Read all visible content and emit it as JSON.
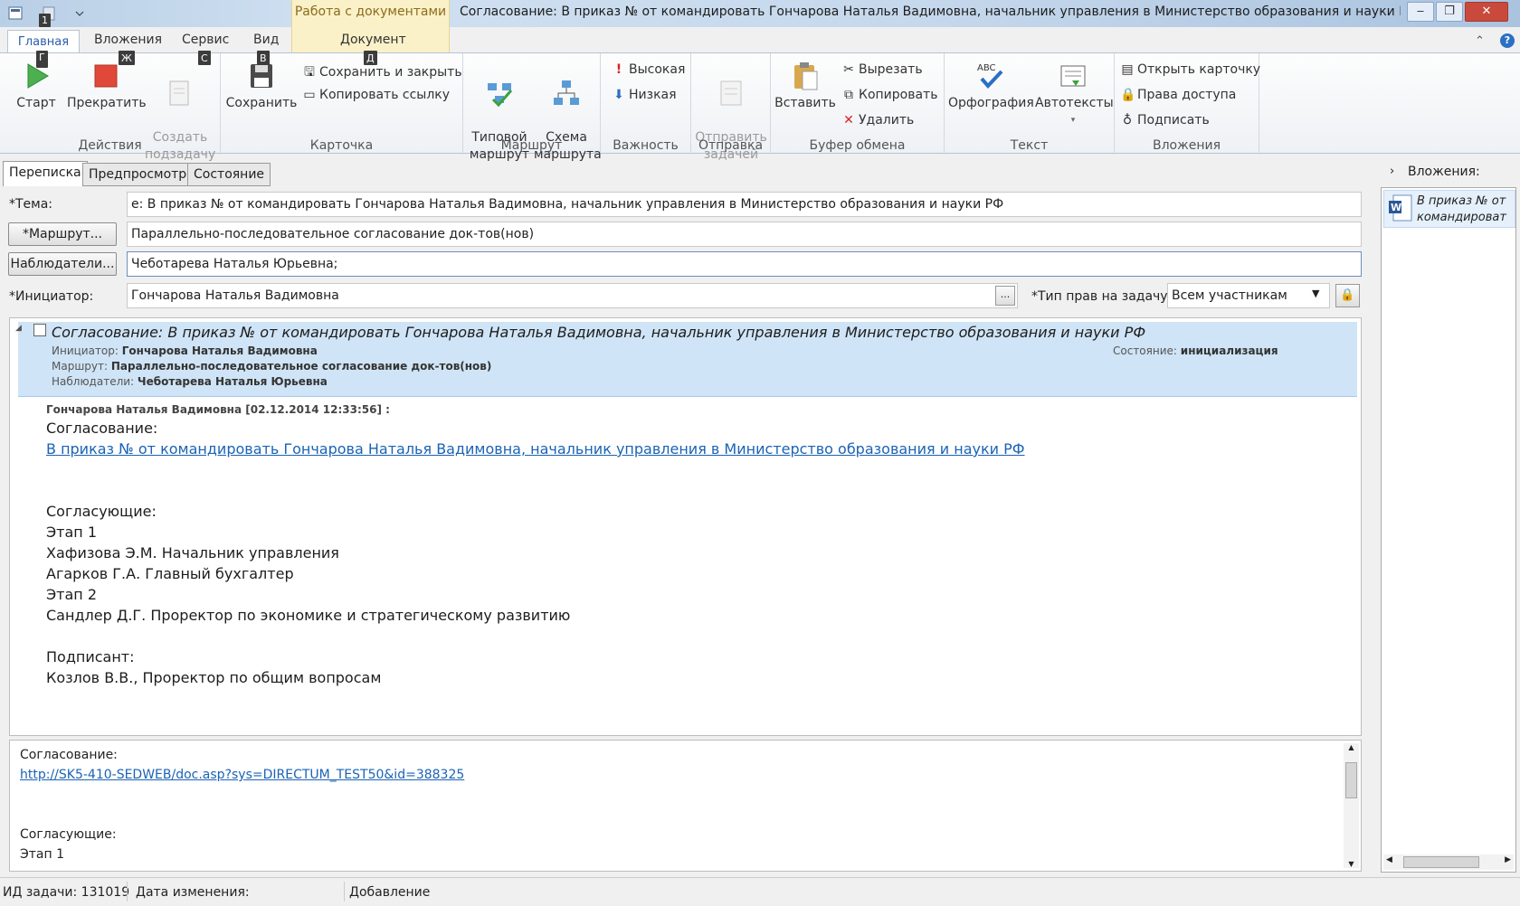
{
  "app": {
    "context_tab_label": "Работа с документами",
    "window_title": "Согласование: В приказ № от  командировать Гончарова Наталья Вадимовна, начальник управления в Министерство образования и науки РФ -"
  },
  "ribbon_tabs": [
    {
      "label": "Главная",
      "keytip": "Г"
    },
    {
      "label": "Вложения",
      "keytip": "Ж"
    },
    {
      "label": "Сервис",
      "keytip": "С"
    },
    {
      "label": "Вид",
      "keytip": "В"
    },
    {
      "label": "Документ",
      "keytip": "Д"
    }
  ],
  "quick_access_keytip": "1",
  "groups": {
    "actions": {
      "label": "Действия",
      "start": "Старт",
      "stop": "Прекратить",
      "create_subtask": "Создать\nподзадачу"
    },
    "card": {
      "label": "Карточка",
      "save": "Сохранить",
      "save_close": "Сохранить и закрыть",
      "copy_link": "Копировать ссылку"
    },
    "route": {
      "label": "Маршрут",
      "typical": "Типовой\nмаршрут",
      "scheme": "Схема\nмаршрута"
    },
    "importance": {
      "label": "Важность",
      "high": "Высокая",
      "low": "Низкая"
    },
    "send": {
      "label": "Отправка",
      "send_task": "Отправить\nзадачей"
    },
    "clipboard": {
      "label": "Буфер обмена",
      "paste": "Вставить",
      "cut": "Вырезать",
      "copy": "Копировать",
      "delete": "Удалить"
    },
    "text": {
      "label": "Текст",
      "spelling": "Орфография",
      "autotext": "Автотексты",
      "abc": "ABC"
    },
    "attachments": {
      "label": "Вложения",
      "open_card": "Открыть карточку",
      "access": "Права доступа",
      "sign": "Подписать"
    }
  },
  "pane_tabs": [
    "Переписка",
    "Предпросмотр",
    "Состояние"
  ],
  "form": {
    "subject_label": "*Тема:",
    "subject_value": "е: В приказ № от  командировать Гончарова Наталья Вадимовна, начальник управления в Министерство образования и науки РФ",
    "route_button": "*Маршрут...",
    "route_value": "Параллельно-последовательное согласование док-тов(нов)",
    "observers_button": "Наблюдатели...",
    "observers_value": "Чеботарева Наталья Юрьевна;",
    "initiator_label": "*Инициатор:",
    "initiator_value": "Гончарова Наталья Вадимовна",
    "ellipsis": "...",
    "rights_label": "*Тип прав на задачу:",
    "rights_value": "Всем участникам"
  },
  "message": {
    "title": "Согласование: В приказ № от командировать Гончарова Наталья Вадимовна, начальник управления в Министерство образования и науки РФ",
    "initiator_label": "Инициатор:",
    "initiator": "Гончарова Наталья Вадимовна",
    "route_label": "Маршрут:",
    "route": "Параллельно-последовательное согласование док-тов(нов)",
    "observers_label": "Наблюдатели:",
    "observers": "Чеботарева Наталья Юрьевна",
    "state_label": "Состояние:",
    "state": "инициализация",
    "author_line": "Гончарова Наталья Вадимовна [02.12.2014 12:33:56] :",
    "body_title": "Согласование:",
    "link": "В приказ № от  командировать Гончарова Наталья Вадимовна, начальник управления в Министерство образования и науки РФ",
    "approvers_label": "Согласующие:",
    "stage1": "Этап 1",
    "approver1": "Хафизова Э.М. Начальник управления",
    "approver2": "Агарков Г.А. Главный бухгалтер",
    "stage2": "Этап 2",
    "approver3": "Сандлер Д.Г. Проректор по экономике и стратегическому развитию",
    "signer_label": "Подписант:",
    "signer": "Козлов В.В., Проректор по общим вопросам"
  },
  "editor": {
    "line1": "Согласование:",
    "link": "http://SK5-410-SEDWEB/doc.asp?sys=DIRECTUM_TEST50&id=388325",
    "line3": "Согласующие:",
    "line4": "Этап 1"
  },
  "attachments_pane": {
    "header": "Вложения:",
    "item": "В приказ № от командироват"
  },
  "status": {
    "task_id": "ИД задачи: 131019",
    "modified": "Дата изменения:",
    "mode": "Добавление"
  }
}
